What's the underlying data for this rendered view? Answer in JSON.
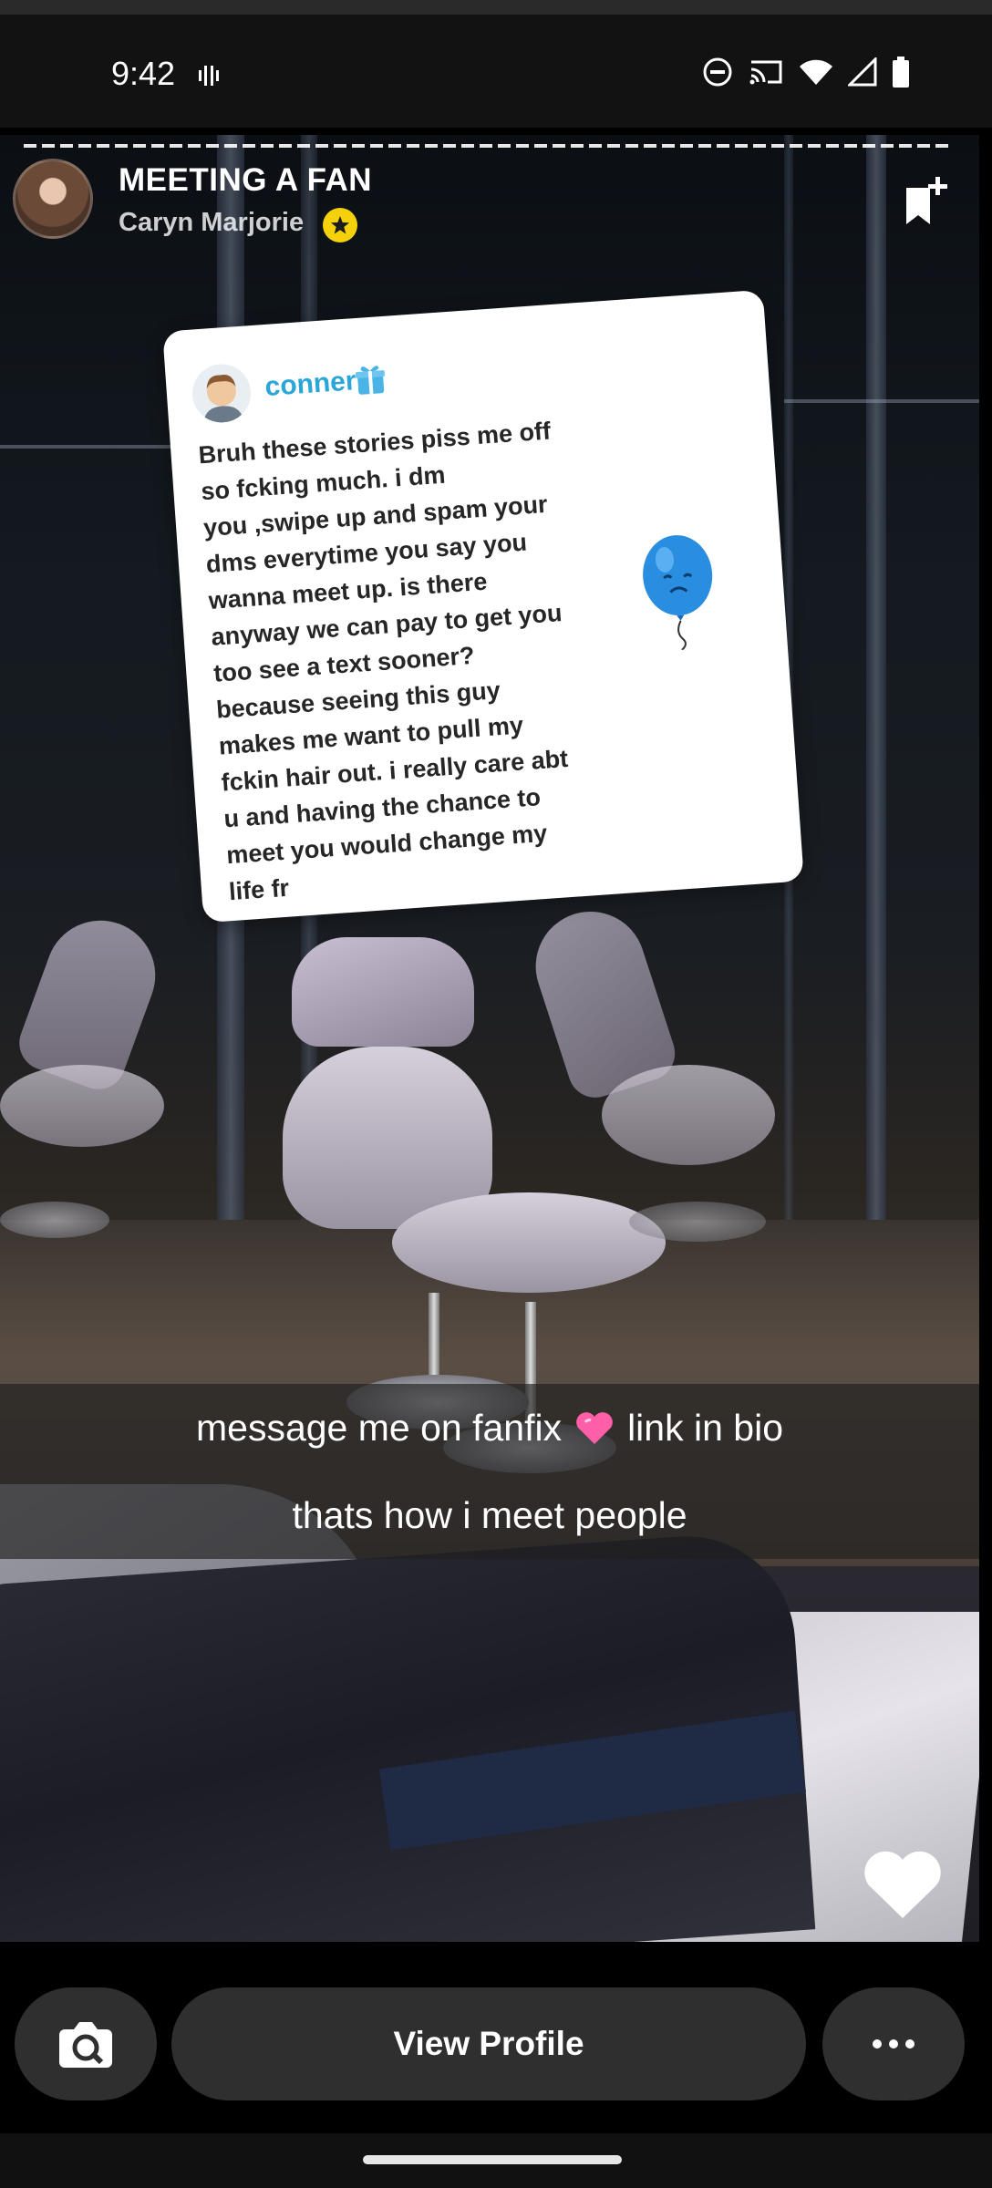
{
  "status_bar": {
    "time": "9:42",
    "icons": [
      "vibrate-icon",
      "do-not-disturb-icon",
      "cast-icon",
      "wifi-icon",
      "cellular-signal-icon",
      "battery-icon"
    ]
  },
  "story": {
    "title": "MEETING A FAN",
    "creator": "Caryn Marjorie",
    "verified": true
  },
  "message_card": {
    "username": "conner",
    "text": "Bruh these stories piss me off\nso fcking much.   i dm\nyou ,swipe up and spam your\ndms everytime you say you\nwanna meet up. is there\nanyway we can pay to get you\ntoo see a text sooner?\nbecause seeing this guy\nmakes me want to pull my\nfckin hair out. i really care abt\nu and having the chance to\nmeet you would change my\nlife fr"
  },
  "captions": {
    "line1_before": "message me on fanfix",
    "line1_after": "link in bio",
    "line2": "thats how i meet people"
  },
  "actions": {
    "view_profile": "View Profile"
  },
  "colors": {
    "username": "#2aa6d8",
    "verified_badge": "#f5d10c",
    "button_bg": "#2f2f2f"
  }
}
